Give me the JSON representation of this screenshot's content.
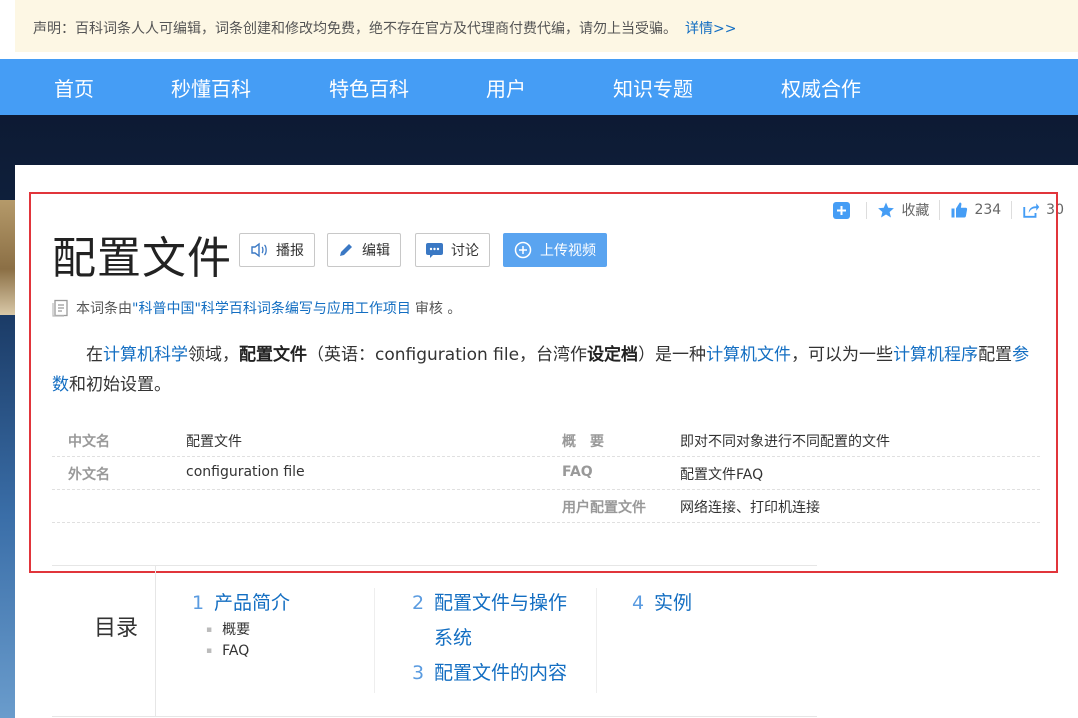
{
  "notice": {
    "text": "声明：百科词条人人可编辑，词条创建和修改均免费，绝不存在官方及代理商付费代编，请勿上当受骗。",
    "link": "详情>>"
  },
  "nav": [
    "首页",
    "秒懂百科",
    "特色百科",
    "用户",
    "知识专题",
    "权威合作"
  ],
  "actions": {
    "collect": "收藏",
    "likes": "234",
    "shares": "30"
  },
  "title": "配置文件",
  "buttons": {
    "broadcast": "播报",
    "edit": "编辑",
    "discuss": "讨论",
    "upload": "上传视频"
  },
  "review": {
    "prefix": "本词条由",
    "org": "\"科普中国\"科学百科词条编写与应用工作项目",
    "suffix": "审核 。"
  },
  "summary": {
    "p1": "在",
    "link1": "计算机科学",
    "p2": "领域，",
    "bold1": "配置文件",
    "p3": "（英语：configuration file，台湾作",
    "bold2": "设定档",
    "p4": "）是一种",
    "link2": "计算机文件",
    "p5": "，可以为一些",
    "link3": "计算机程序",
    "p6": "配置",
    "link4": "参数",
    "p7": "和初始设置。"
  },
  "info": {
    "left": [
      {
        "k": "中文名",
        "v": "配置文件"
      },
      {
        "k": "外文名",
        "v": "configuration file"
      },
      {
        "k": "",
        "v": ""
      }
    ],
    "right": [
      {
        "k": "概　要",
        "v": "即对不同对象进行不同配置的文件"
      },
      {
        "k": "FAQ",
        "v": "配置文件FAQ"
      },
      {
        "k": "用户配置文件",
        "v": "网络连接、打印机连接"
      }
    ]
  },
  "toc": {
    "label": "目录",
    "items": [
      {
        "num": "1",
        "title": "产品简介",
        "subs": [
          "概要",
          "FAQ"
        ]
      },
      {
        "num": "2",
        "title": "配置文件与操作",
        "title2": "系统"
      },
      {
        "num": "3",
        "title": "配置文件的内容"
      },
      {
        "num": "4",
        "title": "实例"
      }
    ]
  },
  "colors": {
    "nav": "#459df5",
    "link": "#136ec2",
    "highlight_border": "#e1353b",
    "notice_bg": "#fdf7e4"
  }
}
